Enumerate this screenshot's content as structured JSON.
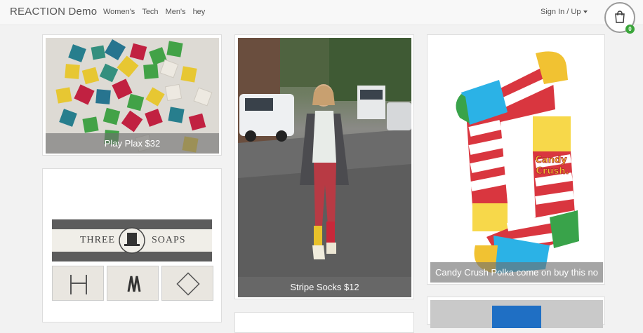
{
  "header": {
    "brand": "REACTION Demo",
    "nav": [
      "Women's",
      "Tech",
      "Men's",
      "hey"
    ],
    "signin": "Sign In / Up",
    "cart_count": "0"
  },
  "products": [
    {
      "title": "Play Plax $32"
    },
    {
      "title": "Stripe Socks $12"
    },
    {
      "title": "Candy Crush Polka come on buy this no"
    },
    {
      "soap_words": [
        "THREE",
        "SOAPS"
      ]
    }
  ],
  "colors": {
    "accent_green": "#3aa53a"
  }
}
